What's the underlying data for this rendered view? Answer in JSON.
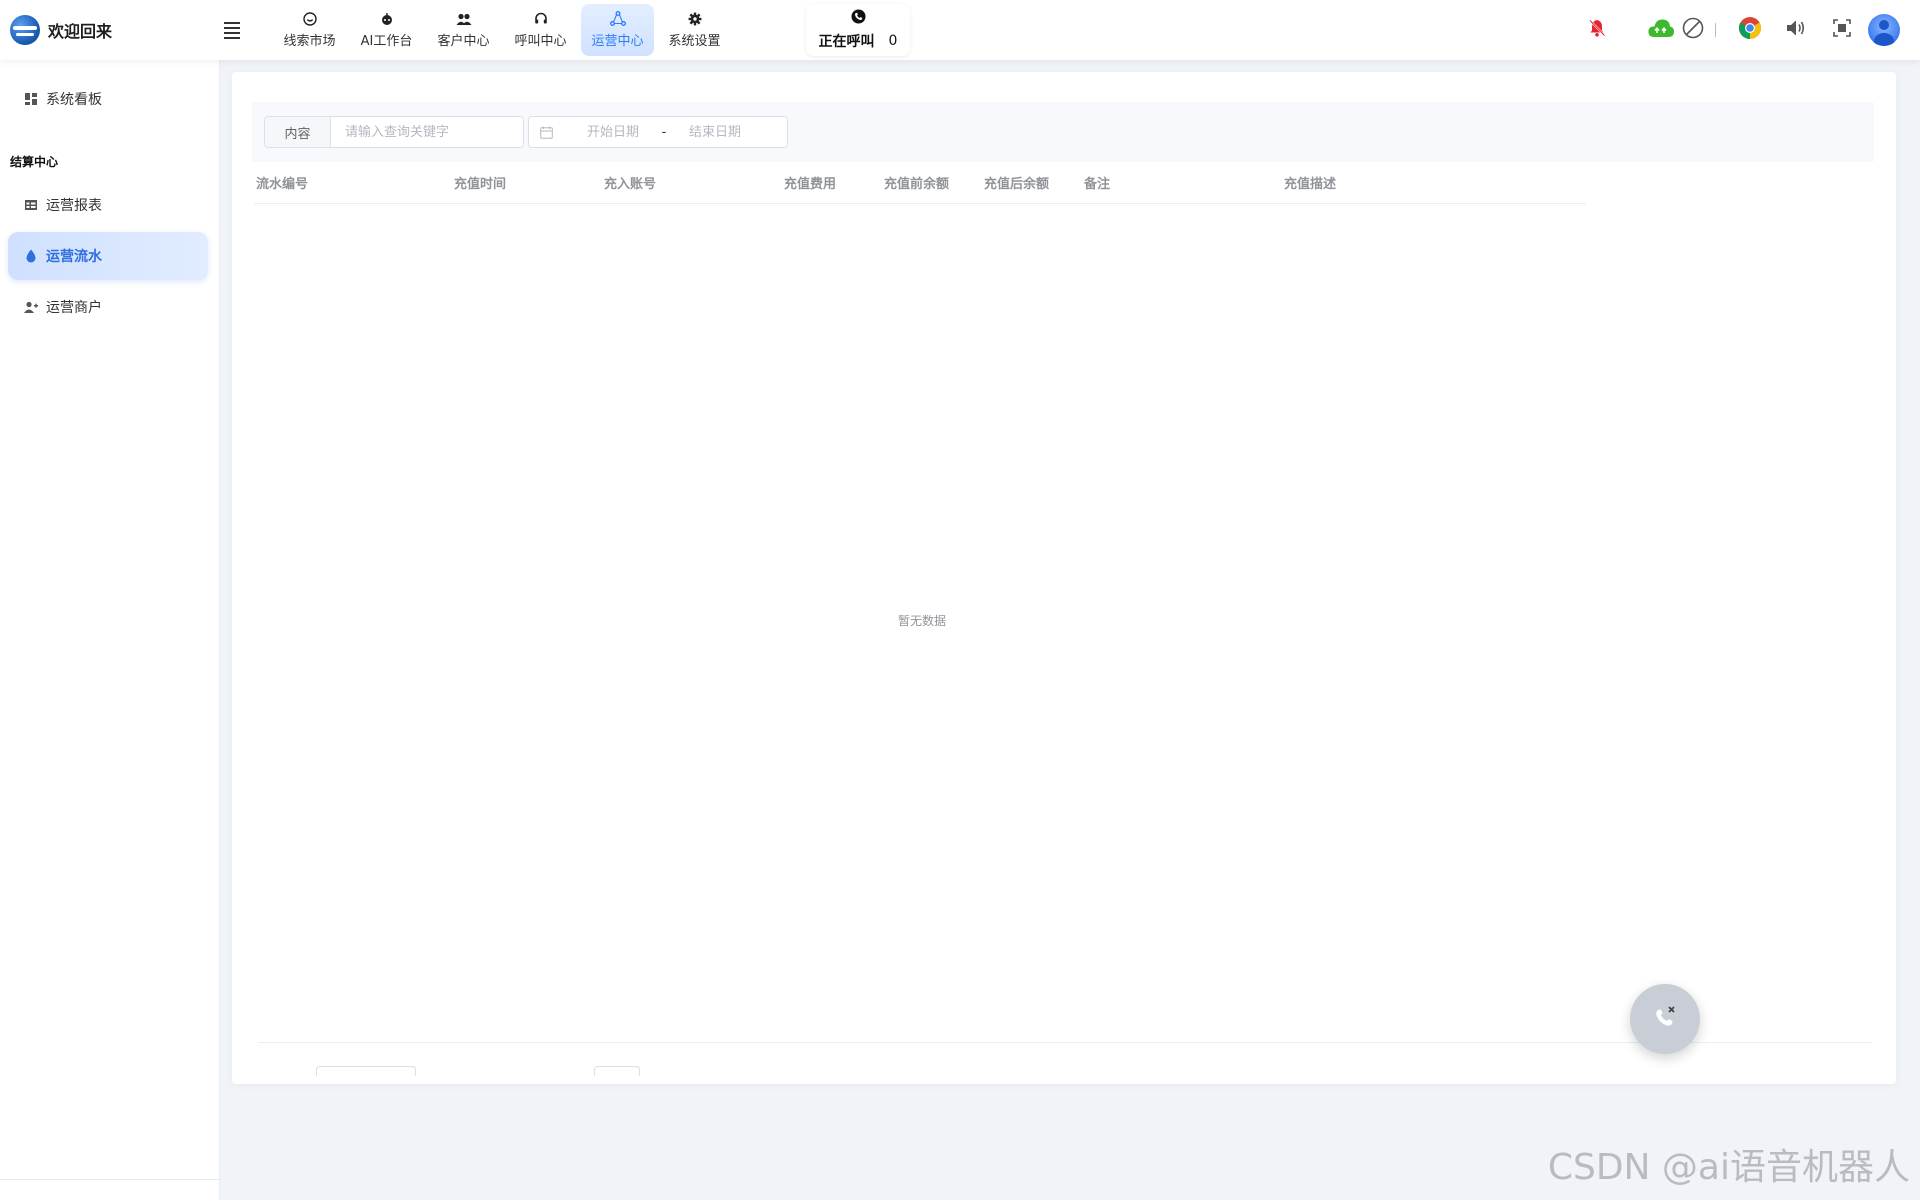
{
  "header": {
    "title": "欢迎回来",
    "nav": [
      {
        "label": "线索市场",
        "icon": "smile-circle-icon"
      },
      {
        "label": "AI工作台",
        "icon": "robot-icon"
      },
      {
        "label": "客户中心",
        "icon": "users-icon"
      },
      {
        "label": "呼叫中心",
        "icon": "headset-icon"
      },
      {
        "label": "运营中心",
        "icon": "network-icon",
        "active": true
      },
      {
        "label": "系统设置",
        "icon": "gear-icon"
      }
    ],
    "calling": {
      "label": "正在呼叫",
      "count": "0"
    }
  },
  "sidebar": {
    "items": [
      {
        "label": "系统看板",
        "icon": "dashboard-icon"
      },
      {
        "label": "运营报表",
        "icon": "report-icon"
      },
      {
        "label": "运营流水",
        "icon": "drop-icon",
        "active": true
      },
      {
        "label": "运营商户",
        "icon": "merchant-icon"
      }
    ],
    "group_label": "结算中心"
  },
  "filter": {
    "content_label": "内容",
    "keyword_placeholder": "请输入查询关键字",
    "start_placeholder": "开始日期",
    "range_separator": "-",
    "end_placeholder": "结束日期"
  },
  "table": {
    "columns": [
      "流水编号",
      "充值时间",
      "充入账号",
      "充值费用",
      "充值前余额",
      "充值后余额",
      "备注",
      "充值描述"
    ],
    "empty_text": "暂无数据"
  },
  "watermark": "CSDN @ai语音机器人",
  "colors": {
    "accent": "#2f7cf6",
    "bell": "#e8222f",
    "cloud": "#3cb92d",
    "page_bg": "#f0f3f7"
  }
}
